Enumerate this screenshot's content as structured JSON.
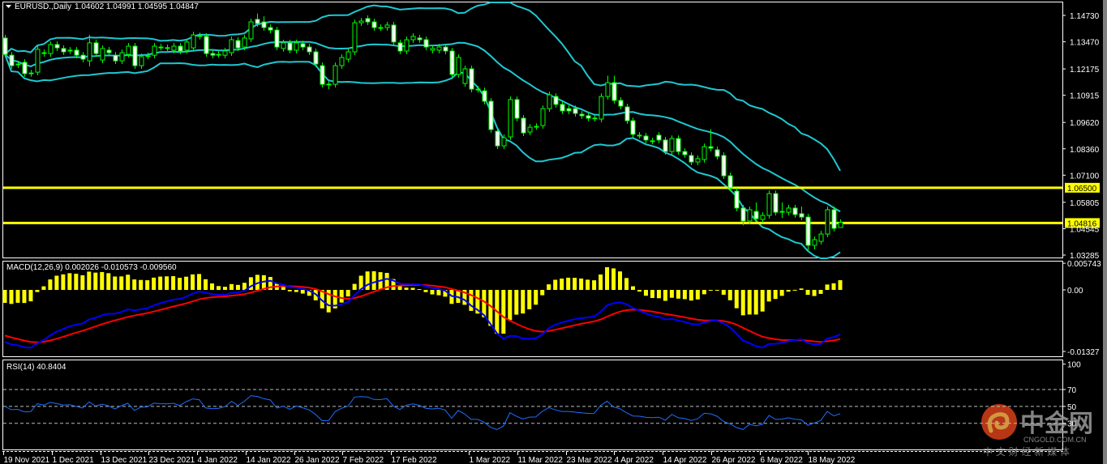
{
  "header": {
    "menu_icon": "triangle-down-icon",
    "symbol_timeframe": "EURUSD.,Daily",
    "ohlc_readout": "1.04602 1.04991 1.04595 1.04847"
  },
  "colors": {
    "background": "#000000",
    "candle_outline": "#00ff00",
    "bear_fill": "#ffffff",
    "bull_fill": "#000000",
    "bollinger": "#1ec8d2",
    "level_line": "#ffff00",
    "macd_hist": "#ffff00",
    "macd_line": "#0000ff",
    "signal_line": "#ff0000",
    "rsi_line": "#1e6fff"
  },
  "price_axis": {
    "ticks": [
      "1.14730",
      "1.13470",
      "1.12175",
      "1.10915",
      "1.09620",
      "1.08360",
      "1.07100",
      "1.05805",
      "1.04545",
      "1.03285"
    ],
    "ylim": [
      1.0313,
      1.1535
    ]
  },
  "levels": [
    {
      "label": "1.06500",
      "value": 1.065
    },
    {
      "label": "1.04816",
      "value": 1.04816
    }
  ],
  "macd": {
    "label": "MACD(12,26,9) 0.002026 -0.010573 -0.009560",
    "axis_ticks": [
      {
        "label": "0.005743",
        "value": 0.005743
      },
      {
        "label": "0.00",
        "value": 0
      },
      {
        "label": "-0.01327",
        "value": -0.01327
      }
    ]
  },
  "rsi": {
    "label": "RSI(14) 40.8404",
    "axis_ticks": [
      {
        "label": "100",
        "value": 100
      },
      {
        "label": "70",
        "value": 70,
        "dashed": true
      },
      {
        "label": "50",
        "value": 50,
        "dashed": true
      },
      {
        "label": "30",
        "value": 30,
        "dashed": true
      }
    ]
  },
  "date_axis": [
    "19 Nov 2021",
    "1 Dec 2021",
    "13 Dec 2021",
    "23 Dec 2021",
    "4 Jan 2022",
    "14 Jan 2022",
    "26 Jan 2022",
    "7 Feb 2022",
    "17 Feb 2022",
    "1 Mar 2022",
    "11 Mar 2022",
    "23 Mar 2022",
    "4 Apr 2022",
    "14 Apr 2022",
    "26 Apr 2022",
    "6 May 2022",
    "18 May 2022"
  ],
  "watermark": {
    "brand": "中金网",
    "domain": "CNGOLD.COM.CN",
    "tagline": "中 文 财 经 新 媒 体"
  },
  "chart_data": {
    "type": "candlestick",
    "title": "EURUSD.,Daily",
    "indicators": [
      "Bollinger Bands",
      "MACD(12,26,9)",
      "RSI(14)"
    ],
    "ylim": [
      1.0313,
      1.1535
    ],
    "grid": false,
    "ohlc": [
      [
        1.1365,
        1.138,
        1.1272,
        1.1287
      ],
      [
        1.1283,
        1.1298,
        1.1218,
        1.1233
      ],
      [
        1.1241,
        1.1256,
        1.1222,
        1.1237
      ],
      [
        1.1249,
        1.1264,
        1.118,
        1.1195
      ],
      [
        1.1195,
        1.1213,
        1.118,
        1.1198
      ],
      [
        1.1202,
        1.1326,
        1.1187,
        1.1311
      ],
      [
        1.1295,
        1.131,
        1.1276,
        1.1291
      ],
      [
        1.1291,
        1.1349,
        1.1276,
        1.1334
      ],
      [
        1.1334,
        1.1349,
        1.1303,
        1.1318
      ],
      [
        1.1315,
        1.133,
        1.1284,
        1.1299
      ],
      [
        1.1307,
        1.1322,
        1.1288,
        1.1303
      ],
      [
        1.1307,
        1.1322,
        1.1268,
        1.1283
      ],
      [
        1.1283,
        1.1298,
        1.1249,
        1.1264
      ],
      [
        1.1256,
        1.138,
        1.123,
        1.1342
      ],
      [
        1.1342,
        1.1357,
        1.1276,
        1.1291
      ],
      [
        1.126,
        1.133,
        1.1245,
        1.1315
      ],
      [
        1.1307,
        1.1322,
        1.128,
        1.1295
      ],
      [
        1.1283,
        1.1298,
        1.1241,
        1.1256
      ],
      [
        1.1256,
        1.131,
        1.1241,
        1.1295
      ],
      [
        1.1287,
        1.1341,
        1.1272,
        1.1326
      ],
      [
        1.1326,
        1.1341,
        1.1218,
        1.1233
      ],
      [
        1.1233,
        1.1291,
        1.1218,
        1.1276
      ],
      [
        1.128,
        1.1295,
        1.1263,
        1.1278
      ],
      [
        1.1283,
        1.1341,
        1.1268,
        1.1326
      ],
      [
        1.1322,
        1.1337,
        1.1306,
        1.1321
      ],
      [
        1.1318,
        1.1334,
        1.1303,
        1.1319
      ],
      [
        1.1307,
        1.1341,
        1.1292,
        1.1326
      ],
      [
        1.1326,
        1.1341,
        1.1288,
        1.1303
      ],
      [
        1.1307,
        1.1361,
        1.1292,
        1.1346
      ],
      [
        1.1318,
        1.1395,
        1.1303,
        1.138
      ],
      [
        1.1376,
        1.1391,
        1.1358,
        1.1373
      ],
      [
        1.1373,
        1.1388,
        1.1276,
        1.1291
      ],
      [
        1.1291,
        1.1306,
        1.1268,
        1.1283
      ],
      [
        1.1287,
        1.1302,
        1.1271,
        1.1286
      ],
      [
        1.1283,
        1.1318,
        1.1268,
        1.1303
      ],
      [
        1.1295,
        1.1372,
        1.128,
        1.1357
      ],
      [
        1.1353,
        1.1368,
        1.1303,
        1.1318
      ],
      [
        1.1322,
        1.138,
        1.1307,
        1.1365
      ],
      [
        1.1361,
        1.1457,
        1.1346,
        1.1442
      ],
      [
        1.1454,
        1.1482,
        1.1419,
        1.1434
      ],
      [
        1.1442,
        1.1469,
        1.14,
        1.1415
      ],
      [
        1.1415,
        1.143,
        1.1388,
        1.1403
      ],
      [
        1.1403,
        1.1418,
        1.1307,
        1.1322
      ],
      [
        1.1315,
        1.1357,
        1.13,
        1.1342
      ],
      [
        1.1342,
        1.1357,
        1.1292,
        1.1307
      ],
      [
        1.1307,
        1.1357,
        1.1292,
        1.1342
      ],
      [
        1.1338,
        1.1353,
        1.1307,
        1.1322
      ],
      [
        1.1322,
        1.1337,
        1.1284,
        1.1299
      ],
      [
        1.1299,
        1.1314,
        1.1226,
        1.1241
      ],
      [
        1.1233,
        1.1248,
        1.1129,
        1.1144
      ],
      [
        1.1144,
        1.116,
        1.1121,
        1.1145
      ],
      [
        1.1144,
        1.1248,
        1.1129,
        1.1233
      ],
      [
        1.1233,
        1.1287,
        1.1218,
        1.1272
      ],
      [
        1.1264,
        1.1314,
        1.1249,
        1.1299
      ],
      [
        1.1299,
        1.1453,
        1.1284,
        1.1438
      ],
      [
        1.1438,
        1.1461,
        1.1423,
        1.1446
      ],
      [
        1.1458,
        1.1473,
        1.1427,
        1.1442
      ],
      [
        1.1442,
        1.1457,
        1.14,
        1.1415
      ],
      [
        1.1415,
        1.143,
        1.1399,
        1.1414
      ],
      [
        1.1415,
        1.1442,
        1.14,
        1.1427
      ],
      [
        1.1427,
        1.1442,
        1.1331,
        1.1346
      ],
      [
        1.1342,
        1.1357,
        1.1288,
        1.1303
      ],
      [
        1.1303,
        1.1372,
        1.1288,
        1.1357
      ],
      [
        1.1357,
        1.1388,
        1.1342,
        1.1373
      ],
      [
        1.1365,
        1.138,
        1.1342,
        1.1357
      ],
      [
        1.1357,
        1.1372,
        1.1307,
        1.1322
      ],
      [
        1.1307,
        1.133,
        1.1292,
        1.1315
      ],
      [
        1.1307,
        1.1337,
        1.1292,
        1.1322
      ],
      [
        1.1322,
        1.1337,
        1.1288,
        1.1303
      ],
      [
        1.1303,
        1.1318,
        1.1176,
        1.1191
      ],
      [
        1.1191,
        1.1287,
        1.1176,
        1.1272
      ],
      [
        1.1148,
        1.1233,
        1.1133,
        1.1218
      ],
      [
        1.1218,
        1.1233,
        1.1106,
        1.1121
      ],
      [
        1.1121,
        1.1136,
        1.1105,
        1.112
      ],
      [
        1.1113,
        1.1128,
        1.1048,
        1.1063
      ],
      [
        1.1063,
        1.1078,
        1.0913,
        1.0928
      ],
      [
        1.092,
        1.0935,
        1.0835,
        1.085
      ],
      [
        1.085,
        1.0904,
        1.0835,
        1.0889
      ],
      [
        1.0893,
        1.1086,
        1.0878,
        1.1071
      ],
      [
        1.1071,
        1.1086,
        1.0967,
        1.0982
      ],
      [
        1.0982,
        1.0997,
        1.0897,
        1.0912
      ],
      [
        1.0916,
        1.0954,
        1.0901,
        1.0939
      ],
      [
        1.0943,
        1.0958,
        1.0927,
        1.0942
      ],
      [
        1.0947,
        1.1043,
        1.0932,
        1.1028
      ],
      [
        1.1028,
        1.1109,
        1.1013,
        1.1094
      ],
      [
        1.1086,
        1.1101,
        1.1033,
        1.1048
      ],
      [
        1.1048,
        1.1063,
        1.1002,
        1.1017
      ],
      [
        1.1028,
        1.1043,
        1.1002,
        1.1017
      ],
      [
        1.1028,
        1.1043,
        1.099,
        1.1005
      ],
      [
        1.1001,
        1.1016,
        1.0979,
        1.0994
      ],
      [
        1.0994,
        1.1009,
        1.0967,
        1.0982
      ],
      [
        1.0982,
        1.0997,
        1.0967,
        1.0983
      ],
      [
        1.0978,
        1.1101,
        1.0963,
        1.1086
      ],
      [
        1.1086,
        1.1185,
        1.1071,
        1.1152
      ],
      [
        1.1152,
        1.1185,
        1.1052,
        1.1067
      ],
      [
        1.1067,
        1.1082,
        1.1025,
        1.104
      ],
      [
        1.1036,
        1.1051,
        1.0955,
        1.097
      ],
      [
        1.097,
        1.0985,
        1.089,
        1.0905
      ],
      [
        1.0901,
        1.0916,
        1.0885,
        1.09
      ],
      [
        1.0897,
        1.0912,
        1.0863,
        1.0878
      ],
      [
        1.0874,
        1.0889,
        1.0858,
        1.0873
      ],
      [
        1.0901,
        1.0916,
        1.0863,
        1.0878
      ],
      [
        1.0878,
        1.0893,
        1.0808,
        1.0823
      ],
      [
        1.0823,
        1.09,
        1.0808,
        1.0885
      ],
      [
        1.0885,
        1.09,
        1.0808,
        1.0823
      ],
      [
        1.0823,
        1.0838,
        1.0793,
        1.0808
      ],
      [
        1.0804,
        1.0819,
        1.0758,
        1.0773
      ],
      [
        1.0773,
        1.0804,
        1.0758,
        1.0789
      ],
      [
        1.0785,
        1.0861,
        1.077,
        1.0846
      ],
      [
        1.0846,
        1.093,
        1.0824,
        1.0839
      ],
      [
        1.0831,
        1.0846,
        1.0785,
        1.08
      ],
      [
        1.0804,
        1.0819,
        1.0692,
        1.0707
      ],
      [
        1.0707,
        1.0722,
        1.0634,
        1.0649
      ],
      [
        1.0634,
        1.0649,
        1.0538,
        1.0553
      ],
      [
        1.0553,
        1.0568,
        1.047,
        1.0491
      ],
      [
        1.0491,
        1.056,
        1.0476,
        1.0545
      ],
      [
        1.0537,
        1.058,
        1.0487,
        1.0502
      ],
      [
        1.0499,
        1.0533,
        1.0484,
        1.0518
      ],
      [
        1.0518,
        1.0637,
        1.0503,
        1.0622
      ],
      [
        1.0622,
        1.0637,
        1.0518,
        1.0533
      ],
      [
        1.0537,
        1.058,
        1.0505,
        1.0536
      ],
      [
        1.0533,
        1.0568,
        1.0518,
        1.0553
      ],
      [
        1.0553,
        1.0568,
        1.0507,
        1.0522
      ],
      [
        1.0526,
        1.056,
        1.0495,
        1.051
      ],
      [
        1.051,
        1.0525,
        1.035,
        1.0375
      ],
      [
        1.0375,
        1.0417,
        1.0355,
        1.0402
      ],
      [
        1.0394,
        1.0444,
        1.0379,
        1.0429
      ],
      [
        1.0429,
        1.056,
        1.0414,
        1.0545
      ],
      [
        1.0545,
        1.056,
        1.0441,
        1.0456
      ],
      [
        1.04602,
        1.04991,
        1.04595,
        1.04847
      ]
    ]
  }
}
